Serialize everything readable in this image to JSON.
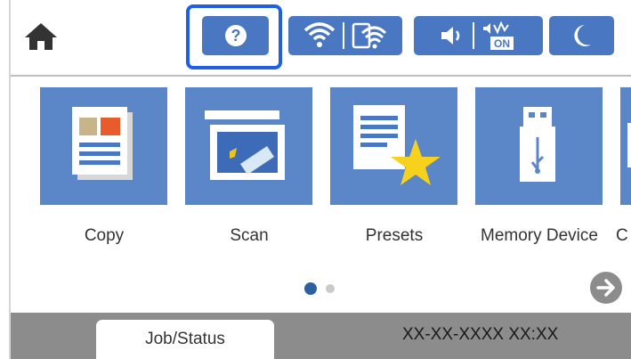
{
  "topbar": {
    "home_icon": "home-icon",
    "help_icon": "question-mark-icon",
    "wifi_icon": "wifi-icon",
    "wifi_direct_icon": "wifi-direct-icon",
    "sound_icon": "speaker-icon",
    "quiet_mode_icon": "quiet-mode-on-icon",
    "quiet_mode_badge": "ON",
    "sleep_icon": "moon-icon",
    "accent_color": "#4a77c2",
    "highlight_color": "#1f5fe8"
  },
  "tiles": [
    {
      "label": "Copy",
      "icon": "copy-icon"
    },
    {
      "label": "Scan",
      "icon": "scan-icon"
    },
    {
      "label": "Presets",
      "icon": "presets-icon"
    },
    {
      "label": "Memory Device",
      "icon": "usb-memory-icon"
    },
    {
      "label": "C",
      "icon": "partial-tile-icon"
    }
  ],
  "pagination": {
    "current_page": 1,
    "total_pages": 2
  },
  "next_icon": "arrow-right-icon",
  "statusbar": {
    "job_status_label": "Job/Status",
    "datetime": "XX-XX-XXXX XX:XX"
  }
}
